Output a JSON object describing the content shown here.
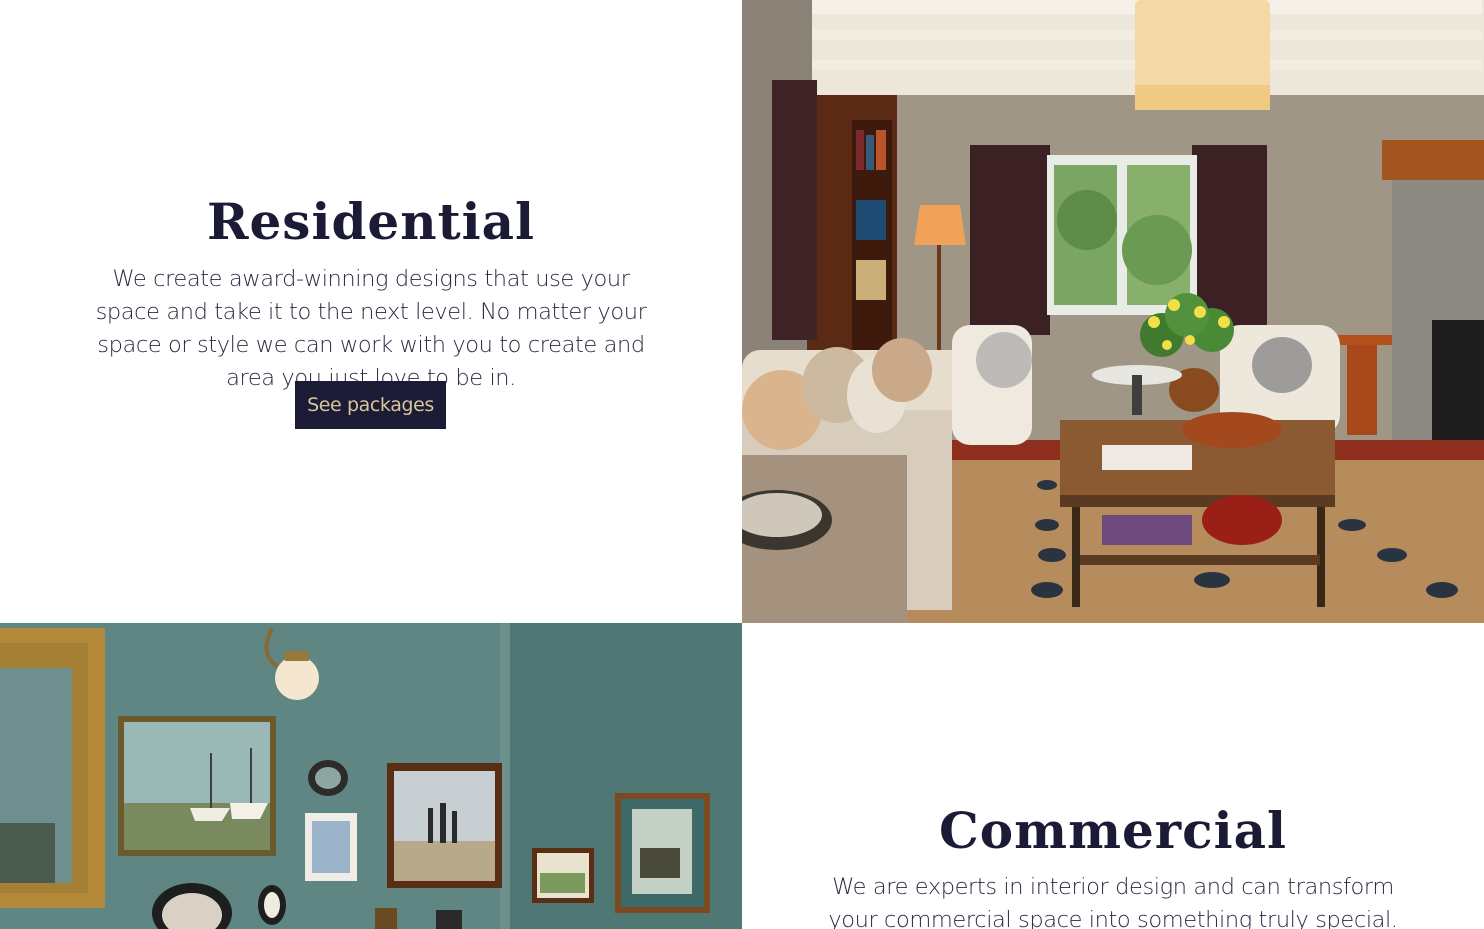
{
  "residential": {
    "title": "Residential",
    "description": "We create award-winning designs that use your space and take it to the next level. No matter your space or style we can work with you to create and area you just love to be in.",
    "button_label": "See packages"
  },
  "commercial": {
    "title": "Commercial",
    "description": "We are experts in interior design and can transform your commercial space into something truly special. We can work"
  },
  "images": {
    "residential": "living-room-photo",
    "commercial": "gallery-wall-photo"
  },
  "colors": {
    "navy": "#1c1b36",
    "button_text": "#d9c49b",
    "wall_teal": "#5b807d"
  }
}
